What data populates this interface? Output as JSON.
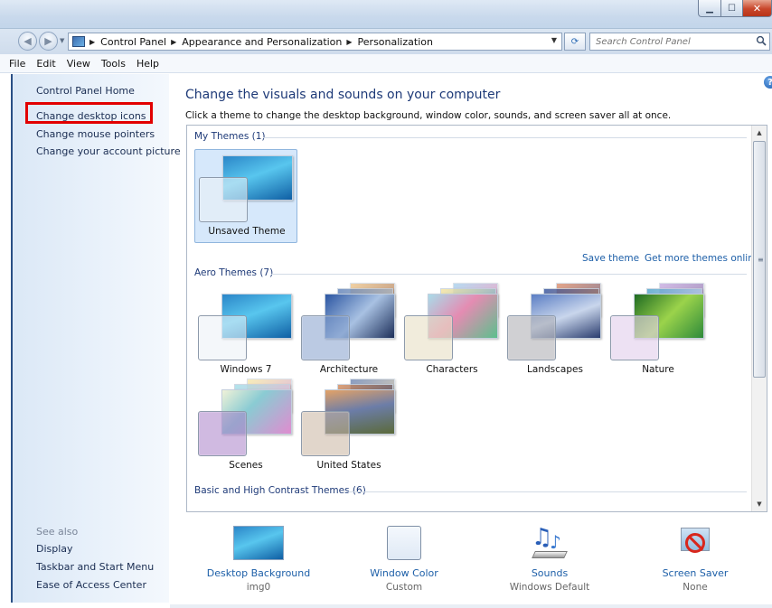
{
  "titlebar": {
    "min_icon": "minimize-icon",
    "max_icon": "maximize-icon",
    "close_icon": "close-icon"
  },
  "address": {
    "crumbs": [
      "Control Panel",
      "Appearance and Personalization",
      "Personalization"
    ],
    "search_placeholder": "Search Control Panel"
  },
  "menu": [
    "File",
    "Edit",
    "View",
    "Tools",
    "Help"
  ],
  "sidebar": {
    "home": "Control Panel Home",
    "links": [
      "Change desktop icons",
      "Change mouse pointers",
      "Change your account picture"
    ],
    "see_also_title": "See also",
    "see_also": [
      "Display",
      "Taskbar and Start Menu",
      "Ease of Access Center"
    ]
  },
  "main": {
    "title": "Change the visuals and sounds on your computer",
    "description": "Click a theme to change the desktop background, window color, sounds, and screen saver all at once.",
    "sections": {
      "my_themes": "My Themes (1)",
      "aero_themes": "Aero Themes (7)",
      "basic_themes": "Basic and High Contrast Themes (6)"
    },
    "my_themes": [
      {
        "name": "Unsaved Theme",
        "selected": true
      }
    ],
    "save_theme": "Save theme",
    "get_more": "Get more themes online",
    "aero_themes": [
      {
        "name": "Windows 7"
      },
      {
        "name": "Architecture"
      },
      {
        "name": "Characters"
      },
      {
        "name": "Landscapes"
      },
      {
        "name": "Nature"
      },
      {
        "name": "Scenes"
      },
      {
        "name": "United States"
      }
    ]
  },
  "bottom": [
    {
      "label": "Desktop Background",
      "value": "img0",
      "icon": "desktop-background-icon"
    },
    {
      "label": "Window Color",
      "value": "Custom",
      "icon": "window-color-icon"
    },
    {
      "label": "Sounds",
      "value": "Windows Default",
      "icon": "sounds-icon"
    },
    {
      "label": "Screen Saver",
      "value": "None",
      "icon": "screen-saver-icon"
    }
  ],
  "colors": {
    "link": "#1d5fa8",
    "title": "#1e3a78",
    "highlight_box": "#e20000",
    "selected_theme_bg": "#d6e8fb"
  }
}
